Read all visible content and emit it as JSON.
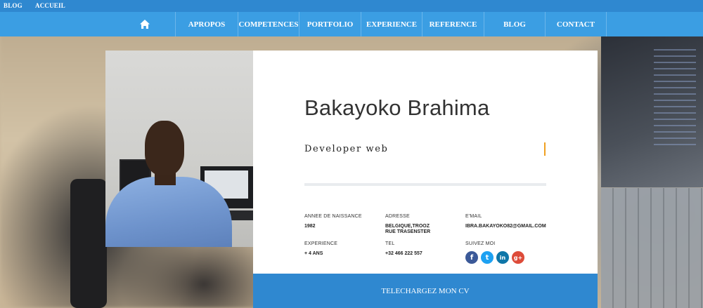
{
  "topbar": {
    "blog": "BLOG",
    "accueil": "ACCUEIL"
  },
  "nav": {
    "home_icon": "home-icon",
    "items": [
      "APROPOS",
      "COMPETENCES",
      "PORTFOLIO",
      "EXPERIENCE",
      "REFERENCE",
      "BLOG",
      "CONTACT"
    ]
  },
  "profile": {
    "name": "Bakayoko Brahima",
    "role": "Developer web",
    "birth_year_label": "ANNEE DE NAISSANCE",
    "birth_year": "1982",
    "address_label": "ADRESSE",
    "address_line1": "BELGIQUE,TROOZ",
    "address_line2": "RUE TRASENSTER",
    "email_label": "E'MAIL",
    "email": "IBRA.BAKAYOKO82@GMAIL.COM",
    "experience_label": "EXPERIENCE",
    "experience": "+ 4 ANS",
    "tel_label": "TEL",
    "tel": "+32 466 222 557",
    "follow_label": "SUIVEZ MOI"
  },
  "socials": [
    {
      "name": "facebook-icon",
      "glyph": "f",
      "color": "#3b5998"
    },
    {
      "name": "twitter-icon",
      "glyph": "t",
      "color": "#1da1f2"
    },
    {
      "name": "linkedin-icon",
      "glyph": "in",
      "color": "#0e76a8"
    },
    {
      "name": "google-plus-icon",
      "glyph": "g+",
      "color": "#dd4b39"
    }
  ],
  "cv_button": "TELECHARGEZ MON CV",
  "colors": {
    "topbar": "#2f88d0",
    "nav": "#3b9ee3",
    "accent": "#f0a020",
    "button": "#2f88d0"
  }
}
